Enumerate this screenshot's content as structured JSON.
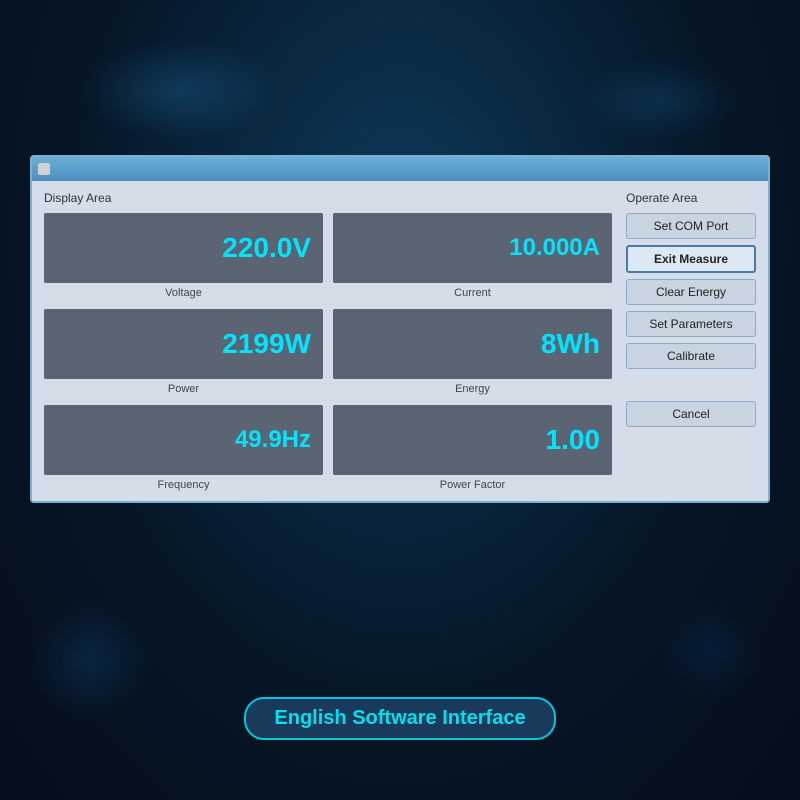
{
  "background": {
    "color": "#0a1a2e"
  },
  "window": {
    "display_area_label": "Display Area",
    "operate_area_label": "Operate Area",
    "metrics": [
      {
        "id": "voltage",
        "value": "220.0V",
        "label": "Voltage"
      },
      {
        "id": "current",
        "value": "10.000A",
        "label": "Current"
      },
      {
        "id": "power",
        "value": "2199W",
        "label": "Power"
      },
      {
        "id": "energy",
        "value": "8Wh",
        "label": "Energy"
      },
      {
        "id": "frequency",
        "value": "49.9Hz",
        "label": "Frequency"
      },
      {
        "id": "power-factor",
        "value": "1.00",
        "label": "Power Factor"
      }
    ],
    "buttons": [
      {
        "id": "set-com-port",
        "label": "Set COM Port",
        "active": false
      },
      {
        "id": "exit-measure",
        "label": "Exit Measure",
        "active": true
      },
      {
        "id": "clear-energy",
        "label": "Clear Energy",
        "active": false
      },
      {
        "id": "set-parameters",
        "label": "Set Parameters",
        "active": false
      },
      {
        "id": "calibrate",
        "label": "Calibrate",
        "active": false
      },
      {
        "id": "cancel",
        "label": "Cancel",
        "active": false
      }
    ]
  },
  "bottom_label": "English Software Interface"
}
